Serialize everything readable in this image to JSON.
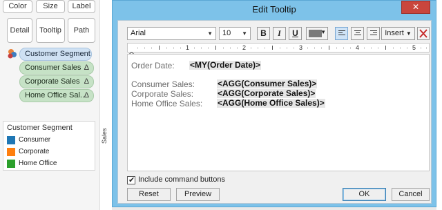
{
  "marks_card": {
    "buttons": [
      "Color",
      "Size",
      "Label",
      "Detail",
      "Tooltip",
      "Path"
    ],
    "pills": [
      {
        "label": "Customer Segment",
        "suffix": "",
        "kind": "dimension"
      },
      {
        "label": "Consumer Sales",
        "suffix": "Δ",
        "kind": "measure"
      },
      {
        "label": "Corporate Sales",
        "suffix": "Δ",
        "kind": "measure"
      },
      {
        "label": "Home Office Sal..",
        "suffix": "Δ",
        "kind": "measure"
      }
    ]
  },
  "legend": {
    "title": "Customer Segment",
    "items": [
      {
        "label": "Consumer",
        "color": "#1f77b4"
      },
      {
        "label": "Corporate",
        "color": "#ff7f0e"
      },
      {
        "label": "Home Office",
        "color": "#2ca02c"
      }
    ]
  },
  "axis": {
    "label": "Sales"
  },
  "dialog": {
    "title": "Edit Tooltip",
    "close_icon": "close-icon",
    "toolbar": {
      "font": "Arial",
      "size": "10",
      "bold": "B",
      "italic": "I",
      "underline": "U",
      "font_color": "#7a7a7a",
      "align": [
        "left",
        "center",
        "right"
      ],
      "align_selected": "left",
      "insert": "Insert",
      "clear_icon": "clear-icon"
    },
    "ruler": {
      "numbers": [
        "1",
        "2",
        "3",
        "4",
        "5"
      ]
    },
    "editor": {
      "lines": [
        {
          "label": "Order Date:",
          "field": "<MY(Order Date)>"
        },
        {
          "label": "Consumer Sales:",
          "field": "<AGG(Consumer Sales)>"
        },
        {
          "label": "Corporate Sales:",
          "field": "<AGG(Corporate Sales)>"
        },
        {
          "label": "Home Office Sales:",
          "field": "<AGG(Home Office Sales)>"
        }
      ]
    },
    "include_buttons": {
      "checked": true,
      "label": "Include command buttons"
    },
    "buttons": {
      "reset": "Reset",
      "preview": "Preview",
      "ok": "OK",
      "cancel": "Cancel"
    }
  }
}
